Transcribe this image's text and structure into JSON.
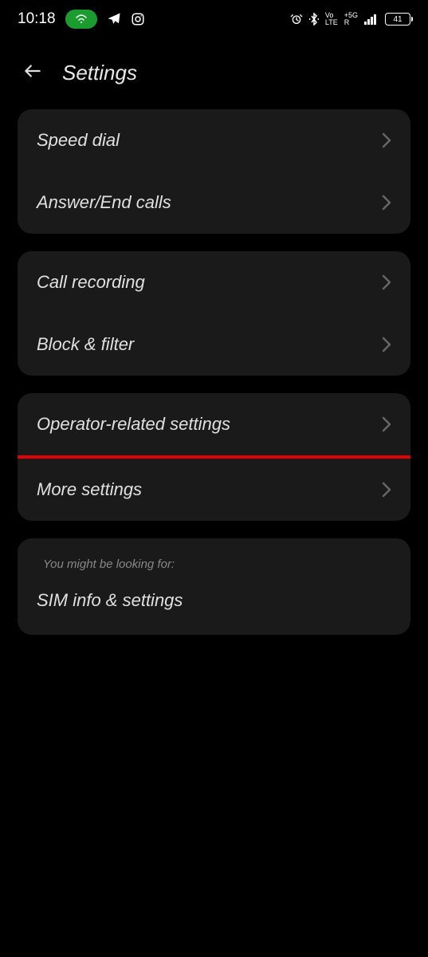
{
  "statusbar": {
    "time": "10:18",
    "battery_level": "41"
  },
  "header": {
    "title": "Settings"
  },
  "group1": {
    "speed_dial": "Speed dial",
    "answer_end": "Answer/End calls"
  },
  "group2": {
    "call_recording": "Call recording",
    "block_filter": "Block & filter"
  },
  "group3": {
    "operator": "Operator-related settings",
    "more": "More settings"
  },
  "group4": {
    "hint": "You might be looking for:",
    "sim": "SIM info & settings"
  }
}
